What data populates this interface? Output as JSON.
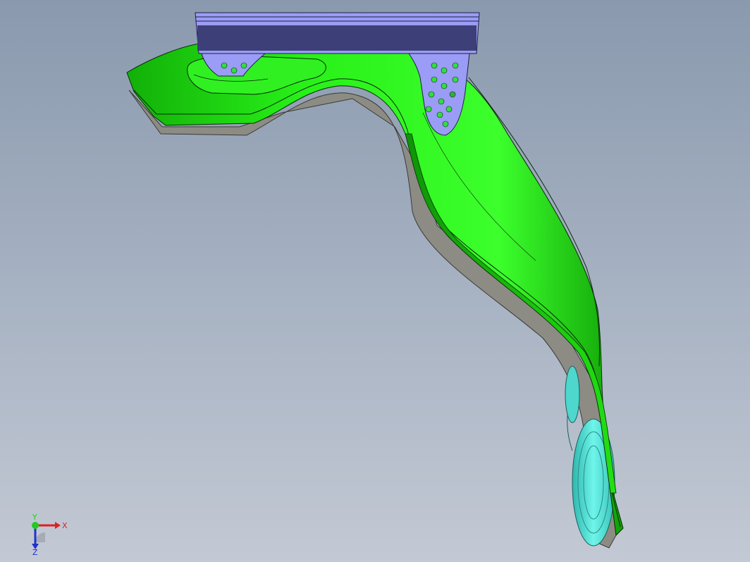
{
  "viewport": {
    "background_top": "#8a99ae",
    "background_bottom": "#c3c9d4"
  },
  "model": {
    "body_color": "#22ee11",
    "body_highlight": "#66ff55",
    "body_shadow": "#14a80a",
    "edge_color": "#0a2a0a",
    "bracket_color": "#9b9cf5",
    "bracket_dark": "#3d3f78",
    "bracket_holes_color": "#33dd44",
    "wheel_color": "#55e8dc",
    "base_plate_color": "#8c8c84"
  },
  "triad": {
    "x_label": "X",
    "y_label": "Y",
    "z_label": "Z",
    "x_color": "#e02020",
    "y_color": "#22cc22",
    "z_color": "#2030d0"
  }
}
